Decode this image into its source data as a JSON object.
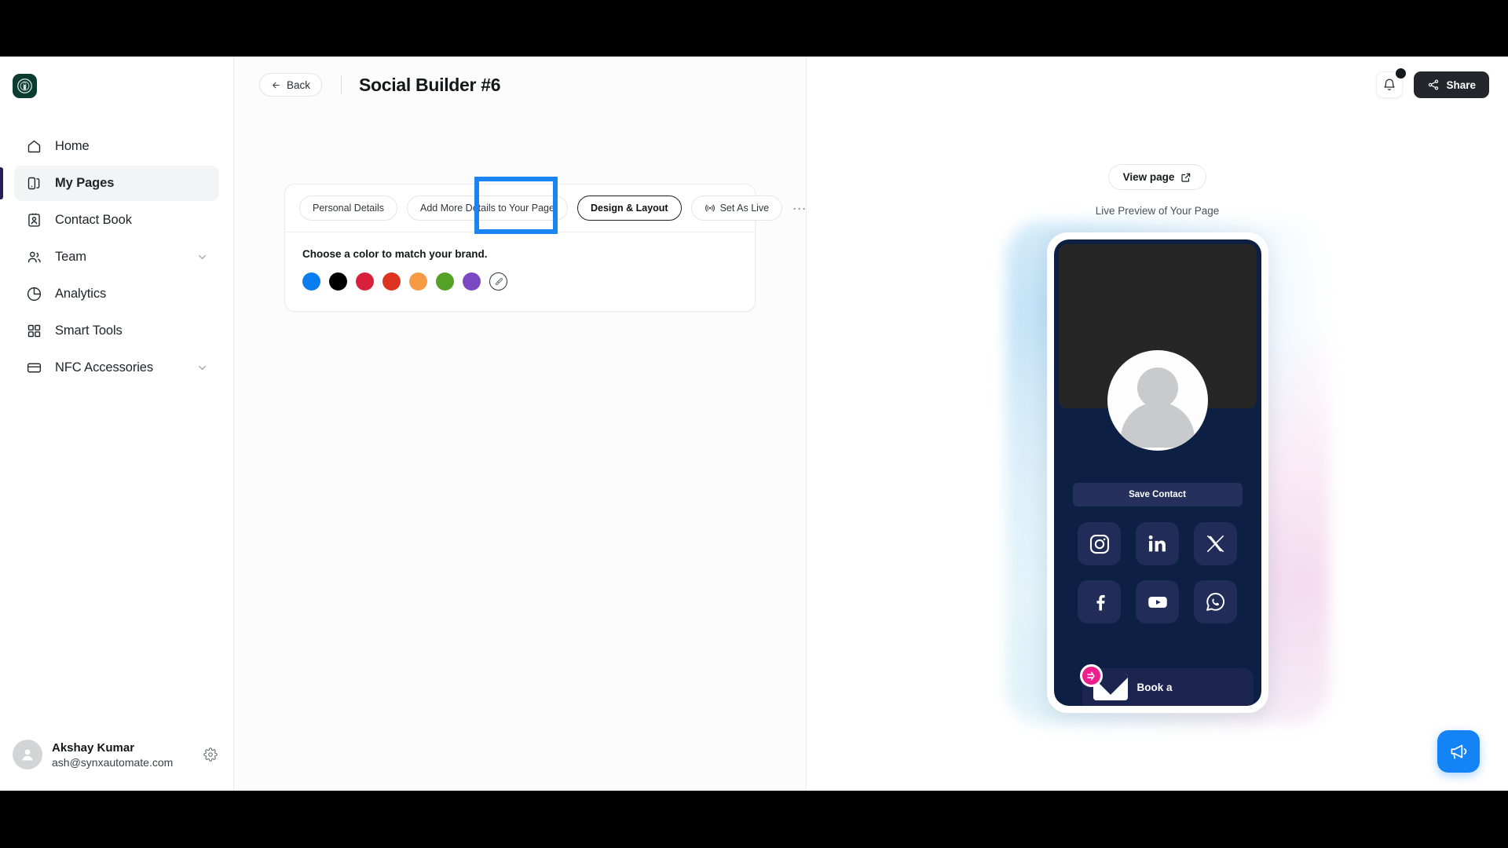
{
  "sidebar": {
    "logo_icon": "starbucks-logo-icon",
    "items": [
      {
        "label": "Home",
        "icon": "home-icon",
        "active": false,
        "has_chevron": false
      },
      {
        "label": "My Pages",
        "icon": "pages-icon",
        "active": true,
        "has_chevron": false
      },
      {
        "label": "Contact Book",
        "icon": "contact-book-icon",
        "active": false,
        "has_chevron": false
      },
      {
        "label": "Team",
        "icon": "team-icon",
        "active": false,
        "has_chevron": true
      },
      {
        "label": "Analytics",
        "icon": "analytics-pie-icon",
        "active": false,
        "has_chevron": false
      },
      {
        "label": "Smart Tools",
        "icon": "grid-icon",
        "active": false,
        "has_chevron": false
      },
      {
        "label": "NFC Accessories",
        "icon": "card-icon",
        "active": false,
        "has_chevron": true
      }
    ],
    "profile": {
      "name": "Akshay Kumar",
      "email": "ash@synxautomate.com",
      "settings_icon": "gear-icon",
      "avatar_icon": "user-avatar-icon"
    }
  },
  "topbar": {
    "back_label": "Back",
    "back_icon": "arrow-left-icon",
    "title": "Social Builder #6"
  },
  "header_actions": {
    "bell_icon": "bell-icon",
    "has_notification": true,
    "share_label": "Share",
    "share_icon": "share-nodes-icon"
  },
  "builder_card": {
    "tabs": [
      {
        "label": "Personal Details",
        "selected": false
      },
      {
        "label": "Add More Details to Your Page",
        "selected": false
      },
      {
        "label": "Design & Layout",
        "selected": true
      }
    ],
    "live_tab": {
      "label": "Set As Live",
      "icon": "broadcast-icon"
    },
    "more_menu": "…",
    "highlight_color": "#1a85f0",
    "section_title": "Choose a color to match your brand.",
    "colors": [
      {
        "name": "blue",
        "hex": "#0a7cf0"
      },
      {
        "name": "black",
        "hex": "#000000"
      },
      {
        "name": "crimson",
        "hex": "#d8203c"
      },
      {
        "name": "red",
        "hex": "#dd3321"
      },
      {
        "name": "orange",
        "hex": "#f79a44"
      },
      {
        "name": "green",
        "hex": "#55a026"
      },
      {
        "name": "purple",
        "hex": "#7a48c0"
      }
    ],
    "custom_color": {
      "name": "custom-color-picker",
      "icon": "eyedropper-icon"
    }
  },
  "preview": {
    "view_page_label": "View page",
    "view_page_icon": "external-link-icon",
    "caption": "Live Preview of Your Page",
    "phone": {
      "background_color": "#0d1f43",
      "banner_color": "#262626",
      "save_contact_label": "Save Contact",
      "socials": [
        {
          "name": "instagram-icon"
        },
        {
          "name": "linkedin-icon"
        },
        {
          "name": "x-twitter-icon"
        },
        {
          "name": "facebook-icon"
        },
        {
          "name": "youtube-icon"
        },
        {
          "name": "whatsapp-icon"
        }
      ],
      "book_label": "Book a",
      "book_icon": "envelope-icon",
      "badge_icon": "logo-badge-icon",
      "badge_color": "#ec1f8c"
    }
  },
  "chat_widget": {
    "icon": "megaphone-icon",
    "color": "#1383f5"
  }
}
